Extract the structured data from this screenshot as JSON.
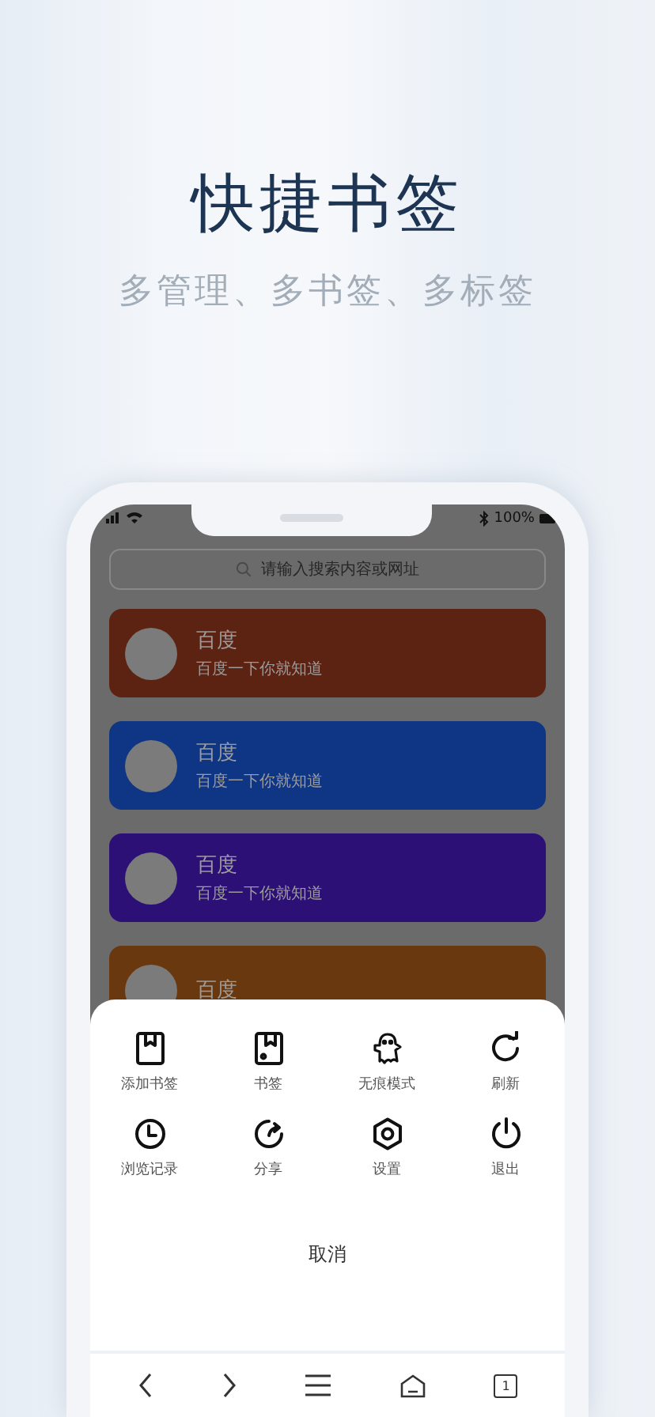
{
  "headline": {
    "title": "快捷书签",
    "subtitle": "多管理、多书签、多标签"
  },
  "status_bar": {
    "battery": "100%"
  },
  "search": {
    "placeholder": "请输入搜索内容或网址"
  },
  "bookmarks": [
    {
      "title": "百度",
      "subtitle": "百度一下你就知道",
      "color": "#5c2212"
    },
    {
      "title": "百度",
      "subtitle": "百度一下你就知道",
      "color": "#0f3684"
    },
    {
      "title": "百度",
      "subtitle": "百度一下你就知道",
      "color": "#2d1076"
    },
    {
      "title": "百度",
      "color": "#6a380e"
    }
  ],
  "menu": {
    "items": [
      {
        "label": "添加书签"
      },
      {
        "label": "书签"
      },
      {
        "label": "无痕模式"
      },
      {
        "label": "刷新"
      },
      {
        "label": "浏览记录"
      },
      {
        "label": "分享"
      },
      {
        "label": "设置"
      },
      {
        "label": "退出"
      }
    ],
    "cancel": "取消"
  },
  "nav": {
    "tab_count": "1"
  }
}
